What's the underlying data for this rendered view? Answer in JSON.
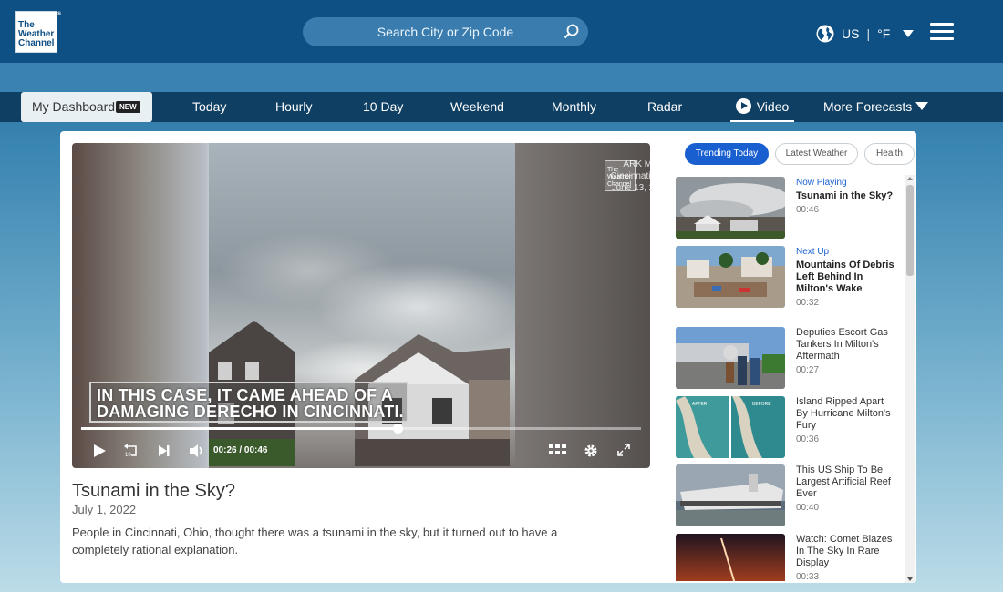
{
  "header": {
    "logo_lines": [
      "The",
      "Weather",
      "Channel"
    ],
    "search_placeholder": "Search City or Zip Code",
    "search_icon": "search-icon",
    "region": "US",
    "unit": "°F",
    "globe_icon": "globe-icon",
    "menu_icon": "hamburger-menu-icon"
  },
  "nav": {
    "dashboard_label": "My Dashboard",
    "new_badge": "NEW",
    "items": [
      "Today",
      "Hourly",
      "10 Day",
      "Weekend",
      "Monthly",
      "Radar",
      "Video",
      "More Forecasts"
    ],
    "active": "Video"
  },
  "player": {
    "credit_line1": "ARK Media",
    "credit_line2": "Cincinnati, OH",
    "credit_line3": "June 13, 2022",
    "watermark_lines": [
      "The",
      "Weather",
      "Channel"
    ],
    "caption_line1": "IN THIS CASE, IT CAME AHEAD OF A",
    "caption_line2": "DAMAGING DERECHO IN CINCINNATI.",
    "current_time": "00:26",
    "duration": "00:46",
    "time_separator": "/",
    "progress_fraction": 0.565
  },
  "video": {
    "title": "Tsunami in the Sky?",
    "date": "July 1, 2022",
    "description": "People in Cincinnati, Ohio, thought there was a tsunami in the sky, but it turned out to have a completely rational explanation."
  },
  "tabs": [
    "Trending Today",
    "Latest Weather",
    "Health"
  ],
  "active_tab": "Trending Today",
  "playlist": [
    {
      "status": "Now Playing",
      "title": "Tsunami in the Sky?",
      "duration": "00:46",
      "bold": true
    },
    {
      "status": "Next Up",
      "title": "Mountains Of Debris Left Behind In Milton's Wake",
      "duration": "00:32",
      "bold": true
    },
    {
      "status": "",
      "title": "Deputies Escort Gas Tankers In Milton's Aftermath",
      "duration": "00:27",
      "bold": false
    },
    {
      "status": "",
      "title": "Island Ripped Apart By Hurricane Milton's Fury",
      "duration": "00:36",
      "bold": false
    },
    {
      "status": "",
      "title": "This US Ship To Be Largest Artificial Reef Ever",
      "duration": "00:40",
      "bold": false
    },
    {
      "status": "",
      "title": "Watch: Comet Blazes In The Sky In Rare Display",
      "duration": "00:33",
      "bold": false
    }
  ],
  "thumb_labels": {
    "after": "AFTER",
    "before": "BEFORE"
  },
  "colors": {
    "header_bg": "#0e4f84",
    "nav_bg": "#0f3f63",
    "accent_blue": "#1a5fd0"
  }
}
